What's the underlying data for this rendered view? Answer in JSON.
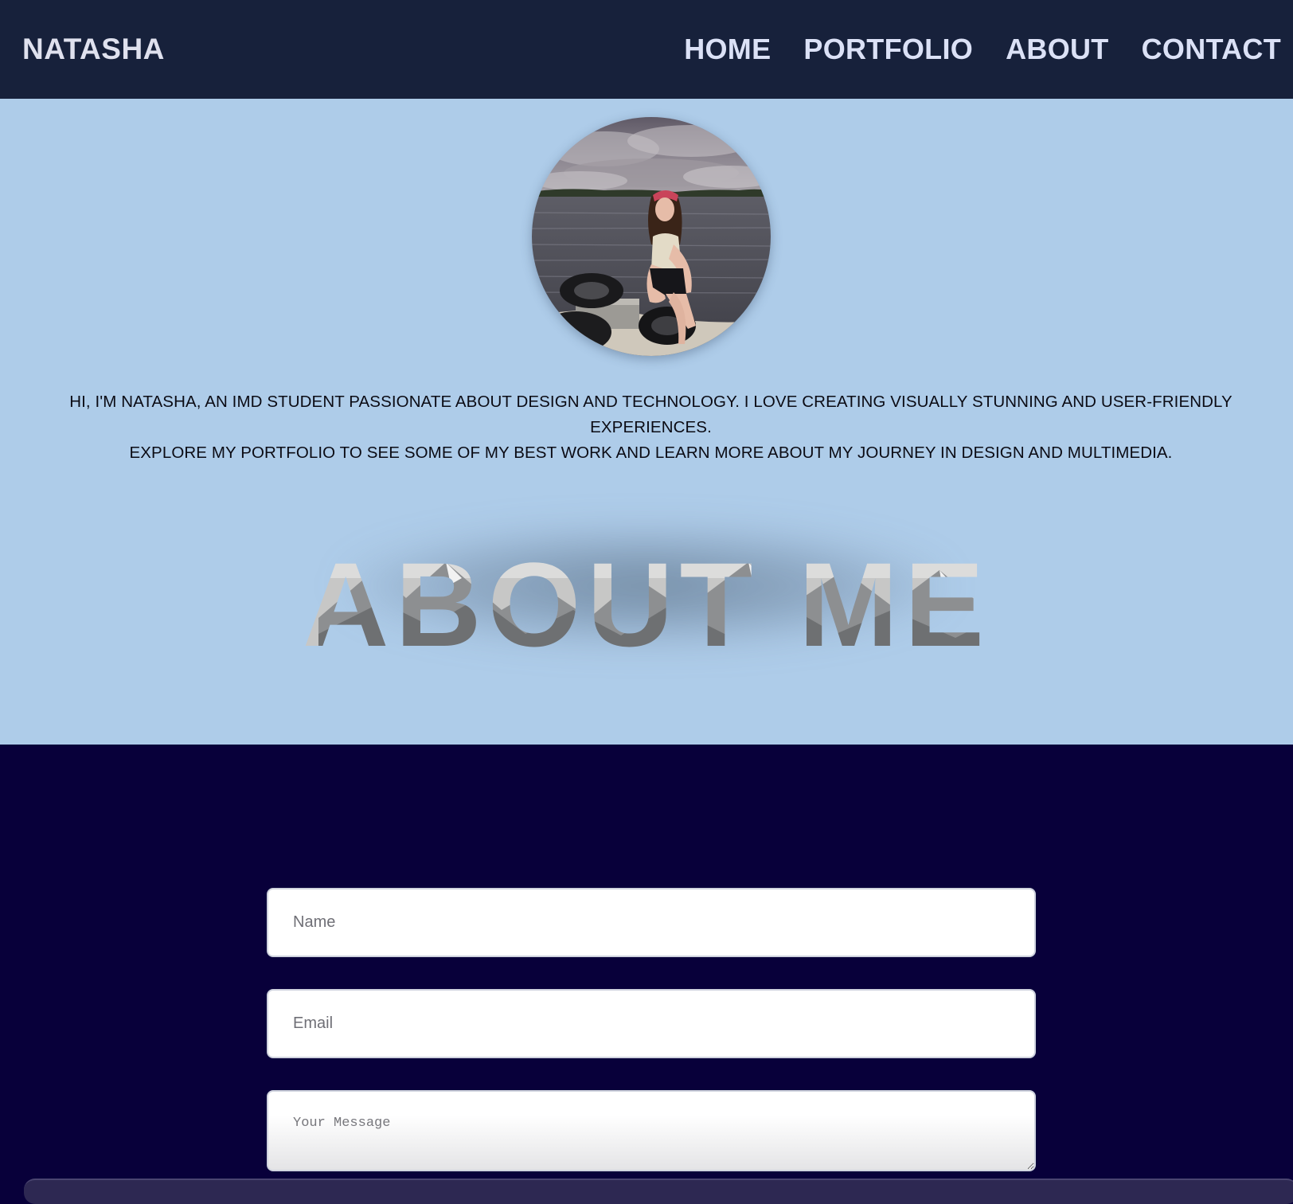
{
  "nav": {
    "brand": "NATASHA",
    "links": [
      "HOME",
      "PORTFOLIO",
      "ABOUT",
      "CONTACT"
    ]
  },
  "about": {
    "intro_line1": "HI, I'M NATASHA, AN IMD STUDENT PASSIONATE ABOUT DESIGN AND TECHNOLOGY. I LOVE CREATING VISUALLY STUNNING AND USER-FRIENDLY EXPERIENCES.",
    "intro_line2": "EXPLORE MY PORTFOLIO TO SEE SOME OF MY BEST WORK AND LEARN MORE ABOUT MY JOURNEY IN DESIGN AND MULTIMEDIA.",
    "title": "ABOUT ME"
  },
  "contact": {
    "name_placeholder": "Name",
    "email_placeholder": "Email",
    "message_placeholder": "Your Message"
  },
  "colors": {
    "nav_bg": "#17213b",
    "about_bg": "#aecce9",
    "contact_bg": "#08003a",
    "nav_text": "#dbe1f6"
  }
}
